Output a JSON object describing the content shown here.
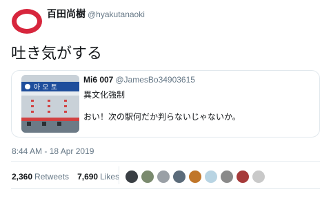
{
  "author": {
    "name": "百田尚樹",
    "handle": "@hyakutanaoki",
    "avatar_color": "#d7263d"
  },
  "tweet_text": "吐き気がする",
  "quoted": {
    "name": "Mi6 007",
    "handle": "@JamesBo34903615",
    "line1": "異文化強制",
    "line2": "おい！次の駅何だか判らないじゃないか。",
    "thumbnail_text": "아 오 토"
  },
  "timestamp": "8:44 AM - 18 Apr 2019",
  "stats": {
    "retweets_count": "2,360",
    "retweets_label": "Retweets",
    "likes_count": "7,690",
    "likes_label": "Likes"
  },
  "likers": [
    "#3a3f44",
    "#7a8a6e",
    "#9aa0a6",
    "#5b6b7a",
    "#c0762a",
    "#b8d4e3",
    "#8a8a8a",
    "#a63a3a",
    "#c9c9c9"
  ]
}
